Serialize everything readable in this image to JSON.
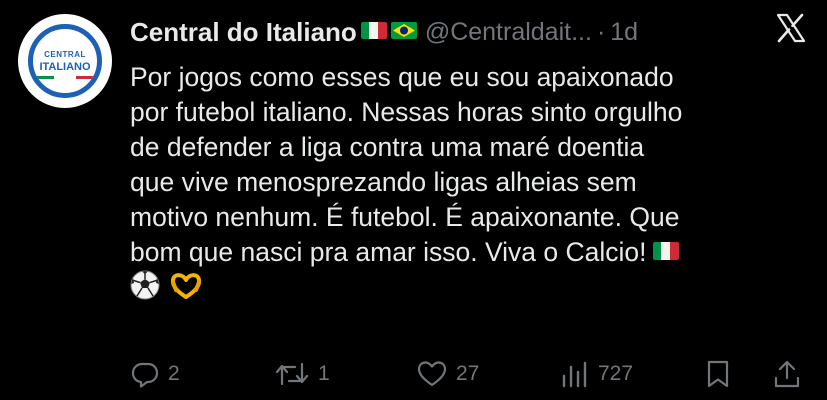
{
  "author": {
    "name": "Central do Italiano",
    "handle": "@Centraldait...",
    "separator": "·",
    "time": "1d",
    "avatar_text_top": "CENTRAL",
    "avatar_text_main": "ITALIANO"
  },
  "tweet": {
    "text": "Por jogos como esses que eu sou apaixonado\npor futebol italiano. Nessas horas sinto orgulho\nde defender a liga contra uma maré doentia\nque vive menosprezando ligas alheias sem\nmotivo nenhum. É futebol. É apaixonante. Que\nbom que nasci pra amar isso. Viva o Calcio!",
    "emojis": [
      "italy-flag",
      "soccer-ball",
      "heart-hands"
    ]
  },
  "actions": {
    "replies": "2",
    "retweets": "1",
    "likes": "27",
    "views": "727"
  },
  "icons": [
    "x-logo-icon",
    "reply-icon",
    "retweet-icon",
    "like-icon",
    "views-icon",
    "bookmark-icon",
    "share-icon"
  ],
  "colors": {
    "background": "#000000",
    "text": "#e7e9ea",
    "secondary": "#71767b",
    "avatar_blue": "#1d60b6"
  }
}
